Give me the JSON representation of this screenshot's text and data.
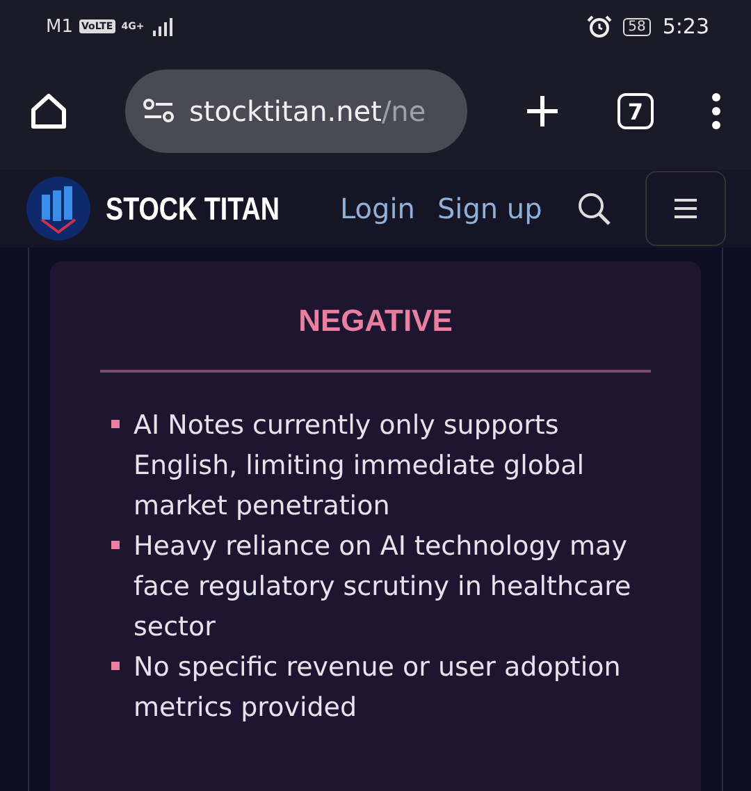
{
  "status_bar": {
    "carrier": "M1",
    "volte": "VoLTE",
    "network": "4G+",
    "battery": "58",
    "time": "5:23"
  },
  "browser": {
    "url_host": "stocktitan.net",
    "url_path": "/ne",
    "tab_count": "7"
  },
  "site_header": {
    "brand": "STOCK TITAN",
    "links": [
      "Login",
      "Sign up"
    ]
  },
  "card": {
    "title": "NEGATIVE",
    "items": [
      "AI Notes currently only supports English, limiting immediate global market penetration",
      "Heavy reliance on AI technology may face regulatory scrutiny in healthcare sector",
      "No specific revenue or user adoption metrics provided"
    ]
  }
}
